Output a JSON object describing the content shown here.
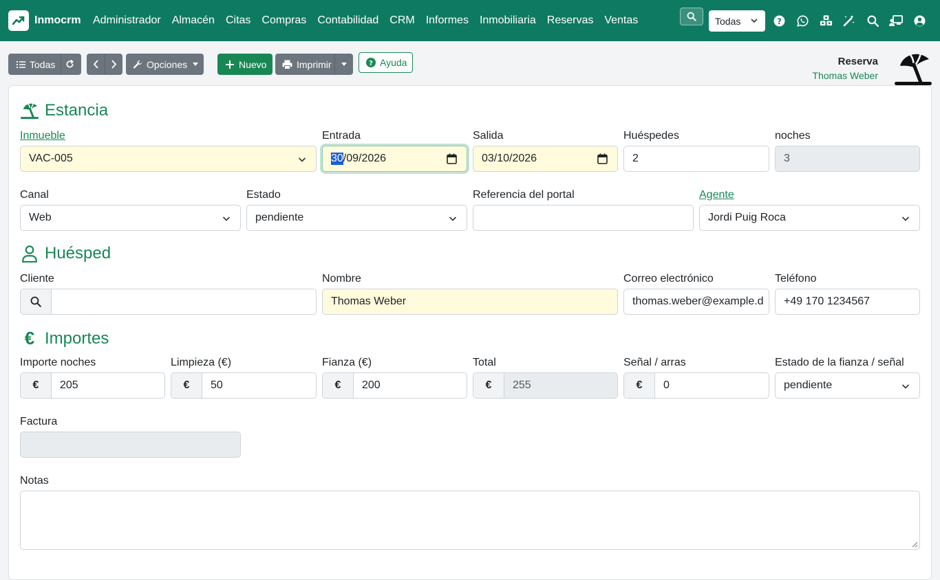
{
  "app": {
    "name": "Inmocrm"
  },
  "menu": [
    "Administrador",
    "Almacén",
    "Citas",
    "Compras",
    "Contabilidad",
    "CRM",
    "Informes",
    "Inmobiliaria",
    "Reservas",
    "Ventas"
  ],
  "company_select": {
    "value": "Todas"
  },
  "nav_icons": [
    "help-icon",
    "whatsapp-icon",
    "cubes-icon",
    "magic-wand-icon",
    "search-icon",
    "chalkboard-user-icon",
    "user-circle-icon"
  ],
  "toolbar": {
    "list_label": "Todas",
    "options_label": "Opciones",
    "new_label": "Nuevo",
    "print_label": "Imprimir",
    "help_label": "Ayuda"
  },
  "doc": {
    "type": "Reserva",
    "subtitle": "Thomas Weber"
  },
  "sections": {
    "stay": "Estancia",
    "guest": "Huésped",
    "amounts": "Importes"
  },
  "stay": {
    "property": {
      "label": "Inmueble",
      "value": "VAC-005"
    },
    "checkin": {
      "label": "Entrada",
      "day": "30",
      "rest": "/09/2026"
    },
    "checkout": {
      "label": "Salida",
      "value": "03/10/2026"
    },
    "guests": {
      "label": "Huéspedes",
      "value": "2"
    },
    "nights": {
      "label": "noches",
      "value": "3"
    },
    "channel": {
      "label": "Canal",
      "value": "Web"
    },
    "status": {
      "label": "Estado",
      "value": "pendiente"
    },
    "portal_ref": {
      "label": "Referencia del portal",
      "value": ""
    },
    "agent": {
      "label": "Agente",
      "value": "Jordi Puig Roca"
    }
  },
  "guest": {
    "client": {
      "label": "Cliente",
      "value": ""
    },
    "name": {
      "label": "Nombre",
      "value": "Thomas Weber"
    },
    "email": {
      "label": "Correo electrónico",
      "value": "thomas.weber@example.d"
    },
    "phone": {
      "label": "Teléfono",
      "value": "+49 170 1234567"
    }
  },
  "amounts": {
    "currency_symbol": "€",
    "nights_amount": {
      "label": "Importe noches",
      "value": "205"
    },
    "cleaning": {
      "label": "Limpieza (€)",
      "value": "50"
    },
    "deposit": {
      "label": "Fianza (€)",
      "value": "200"
    },
    "total": {
      "label": "Total",
      "value": "255"
    },
    "signal": {
      "label": "Señal / arras",
      "value": "0"
    },
    "deposit_status": {
      "label": "Estado de la fianza / señal",
      "value": "pendiente"
    },
    "invoice": {
      "label": "Factura",
      "value": ""
    },
    "notes": {
      "label": "Notas",
      "value": ""
    }
  },
  "colors": {
    "navbar": "#0f7a62",
    "accent": "#198754",
    "input_highlight": "#fffbdc",
    "readonly": "#e9ecef"
  }
}
